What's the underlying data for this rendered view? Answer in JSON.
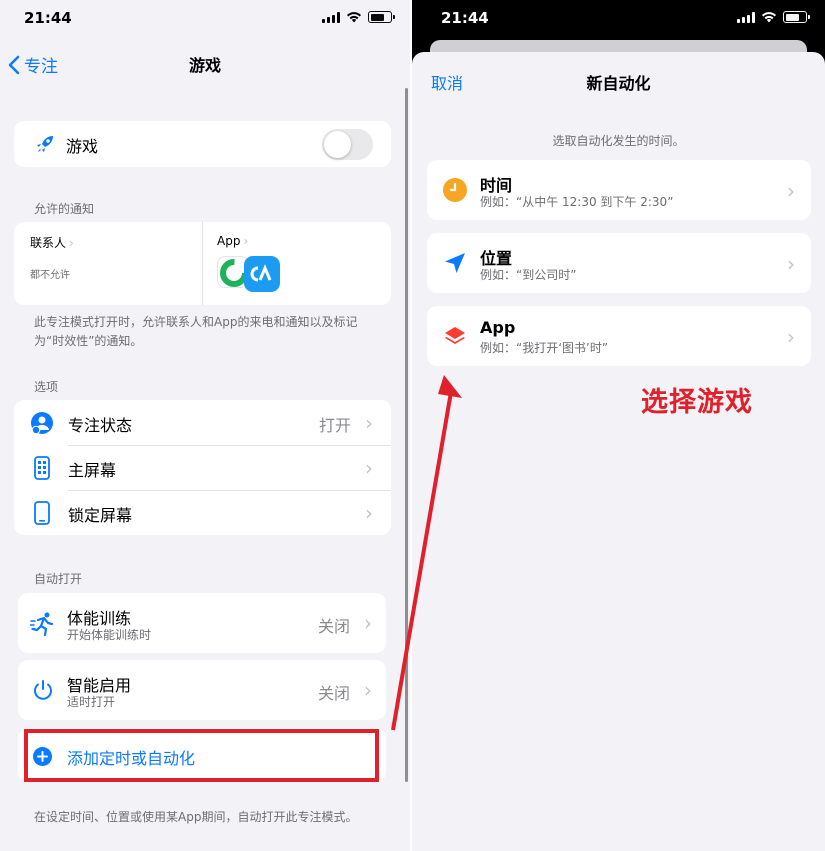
{
  "left": {
    "status_time": "21:44",
    "nav": {
      "back_label": "专注",
      "title": "游戏"
    },
    "focus_toggle": {
      "label": "游戏",
      "on": false
    },
    "allowed_header": "允许的通知",
    "contacts": {
      "label": "联系人",
      "value": "都不允许"
    },
    "apps": {
      "label": "App"
    },
    "allowed_footer": "此专注模式打开时，允许联系人和App的来电和通知以及标记为“时效性”的通知。",
    "options_header": "选项",
    "options": [
      {
        "label": "专注状态",
        "value": "打开",
        "icon": "focus-status-icon"
      },
      {
        "label": "主屏幕",
        "value": "",
        "icon": "home-screen-icon"
      },
      {
        "label": "锁定屏幕",
        "value": "",
        "icon": "lock-screen-icon"
      }
    ],
    "auto_header": "自动打开",
    "auto": [
      {
        "title": "体能训练",
        "subtitle": "开始体能训练时",
        "value": "关闭",
        "icon": "workout-icon"
      },
      {
        "title": "智能启用",
        "subtitle": "适时打开",
        "value": "关闭",
        "icon": "power-icon"
      }
    ],
    "add_label": "添加定时或自动化",
    "auto_footer": "在设定时间、位置或使用某App期间，自动打开此专注模式。",
    "colors": {
      "accent": "#0a7aff",
      "highlight": "#e0202a"
    }
  },
  "right": {
    "status_time": "21:44",
    "cancel_label": "取消",
    "title": "新自动化",
    "prompt": "选取自动化发生的时间。",
    "options": [
      {
        "title": "时间",
        "subtitle": "例如：“从中午 12:30 到下午 2:30”",
        "icon": "clock-icon",
        "color": "#f5a623"
      },
      {
        "title": "位置",
        "subtitle": "例如：“到公司时”",
        "icon": "location-arrow-icon",
        "color": "#0a7aff"
      },
      {
        "title": "App",
        "subtitle": "例如：“我打开‘图书’时”",
        "icon": "app-layers-icon",
        "color": "#ff3b30"
      }
    ]
  },
  "annotation": "选择游戏"
}
